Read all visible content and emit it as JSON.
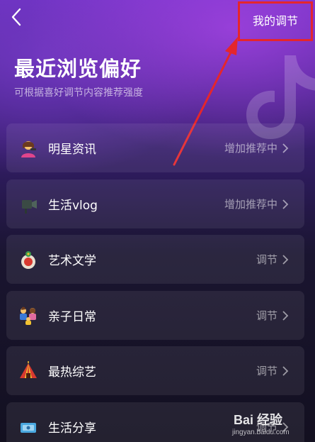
{
  "header": {
    "back_icon": "chevron-left-icon",
    "my_adjust_label": "我的调节"
  },
  "page": {
    "title": "最近浏览偏好",
    "subtitle": "可根据喜好调节内容推荐强度"
  },
  "items": [
    {
      "icon": "celebrity-emoji-icon",
      "name": "明星资讯",
      "action": "增加推荐中"
    },
    {
      "icon": "camera-emoji-icon",
      "name": "生活vlog",
      "action": "增加推荐中"
    },
    {
      "icon": "art-emoji-icon",
      "name": "艺术文学",
      "action": "调节"
    },
    {
      "icon": "family-emoji-icon",
      "name": "亲子日常",
      "action": "调节"
    },
    {
      "icon": "circus-tent-emoji-icon",
      "name": "最热综艺",
      "action": "调节"
    },
    {
      "icon": "share-emoji-icon",
      "name": "生活分享",
      "action": "调节"
    }
  ],
  "watermark": {
    "logo_text": "Bai 经验",
    "url": "jingyan.baidu.com"
  },
  "colors": {
    "annotation_red": "#e5262c",
    "accent_purple": "#6a2fc0"
  }
}
